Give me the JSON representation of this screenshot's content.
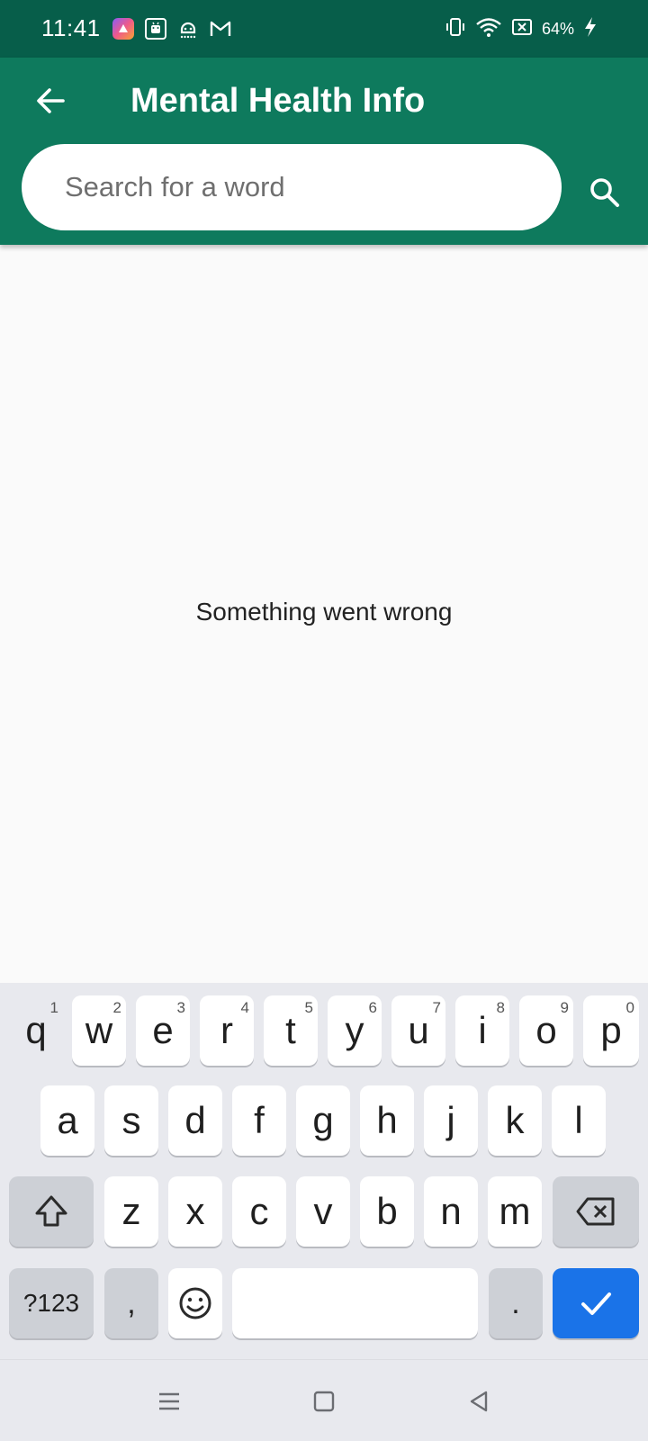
{
  "status_bar": {
    "time": "11:41",
    "battery": "64%",
    "notification_icons": [
      "app-notification-icon",
      "android-icon",
      "alien-icon",
      "gmail-icon"
    ],
    "system_icons": [
      "vibrate-icon",
      "wifi-icon",
      "no-sim-icon",
      "battery-charging-icon"
    ]
  },
  "app_bar": {
    "title": "Mental Health Info",
    "background": "#0e7a5d",
    "status_background": "#075e4a"
  },
  "search": {
    "placeholder": "Search for a word",
    "value": ""
  },
  "content": {
    "message": "Something went wrong"
  },
  "keyboard": {
    "row1": [
      {
        "key": "q",
        "hint": "1"
      },
      {
        "key": "w",
        "hint": "2"
      },
      {
        "key": "e",
        "hint": "3"
      },
      {
        "key": "r",
        "hint": "4"
      },
      {
        "key": "t",
        "hint": "5"
      },
      {
        "key": "y",
        "hint": "6"
      },
      {
        "key": "u",
        "hint": "7"
      },
      {
        "key": "i",
        "hint": "8"
      },
      {
        "key": "o",
        "hint": "9"
      },
      {
        "key": "p",
        "hint": "0"
      }
    ],
    "row2": [
      "a",
      "s",
      "d",
      "f",
      "g",
      "h",
      "j",
      "k",
      "l"
    ],
    "row3": [
      "z",
      "x",
      "c",
      "v",
      "b",
      "n",
      "m"
    ],
    "symbols_label": "?123",
    "comma_label": ",",
    "period_label": ".",
    "accent": "#1a73e8"
  }
}
